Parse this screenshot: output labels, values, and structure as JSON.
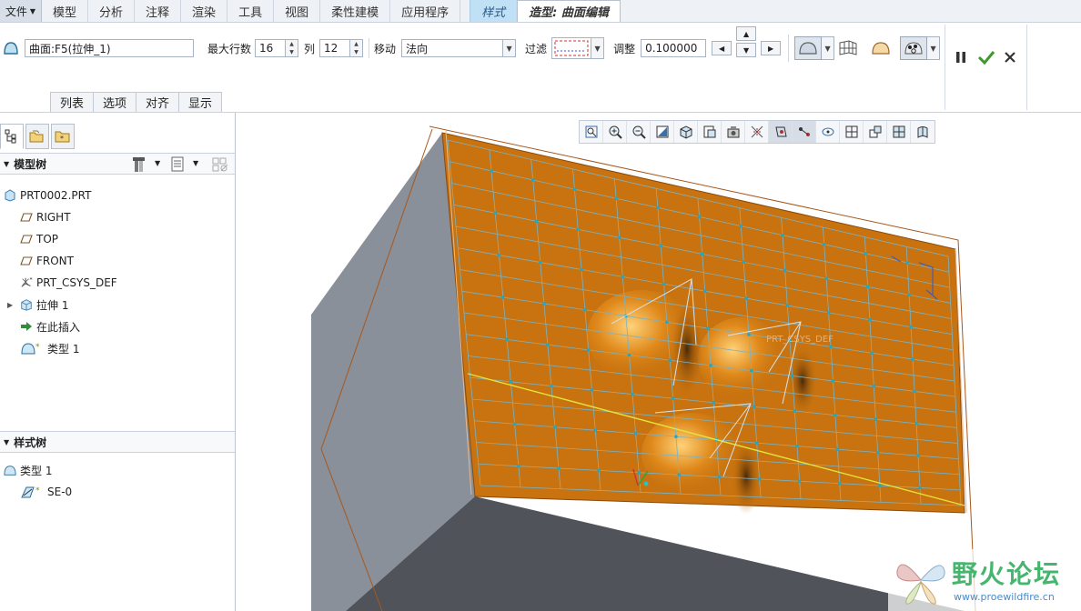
{
  "menubar": {
    "file": "文件",
    "tabs": [
      "模型",
      "分析",
      "注释",
      "渲染",
      "工具",
      "视图",
      "柔性建模",
      "应用程序"
    ],
    "style_tab": "样式",
    "active_tab": "造型: 曲面编辑"
  },
  "ribbon": {
    "surface_value": "曲面:F5(拉伸_1)",
    "max_rows_label": "最大行数",
    "max_rows_value": "16",
    "cols_label": "列",
    "cols_value": "12",
    "move_label": "移动",
    "move_value": "法向",
    "filter_label": "过滤",
    "adjust_label": "调整",
    "adjust_value": "0.100000",
    "subtabs": [
      "列表",
      "选项",
      "对齐",
      "显示"
    ]
  },
  "model_tree": {
    "title": "模型树",
    "items": [
      {
        "label": "PRT0002.PRT",
        "icon": "part-icon"
      },
      {
        "label": "RIGHT",
        "icon": "datum-plane-icon"
      },
      {
        "label": "TOP",
        "icon": "datum-plane-icon"
      },
      {
        "label": "FRONT",
        "icon": "datum-plane-icon"
      },
      {
        "label": "PRT_CSYS_DEF",
        "icon": "csys-icon"
      },
      {
        "label": "拉伸 1",
        "icon": "extrude-icon"
      },
      {
        "label": "在此插入",
        "icon": "insert-here-arrow-icon"
      },
      {
        "label": "类型 1",
        "icon": "style-feature-icon"
      }
    ]
  },
  "style_tree": {
    "title": "样式树",
    "items": [
      {
        "label": "类型 1",
        "icon": "style-feature-icon"
      },
      {
        "label": "SE-0",
        "icon": "surface-edit-icon"
      }
    ]
  },
  "graphics": {
    "csys_label": "PRT_CSYS_DEF",
    "surface_color": "#c8730f",
    "mesh_color": "#79b3c6",
    "point_color": "#1aa9c9"
  },
  "watermark": {
    "title": "野火论坛",
    "url": "www.proewildfire.cn"
  }
}
